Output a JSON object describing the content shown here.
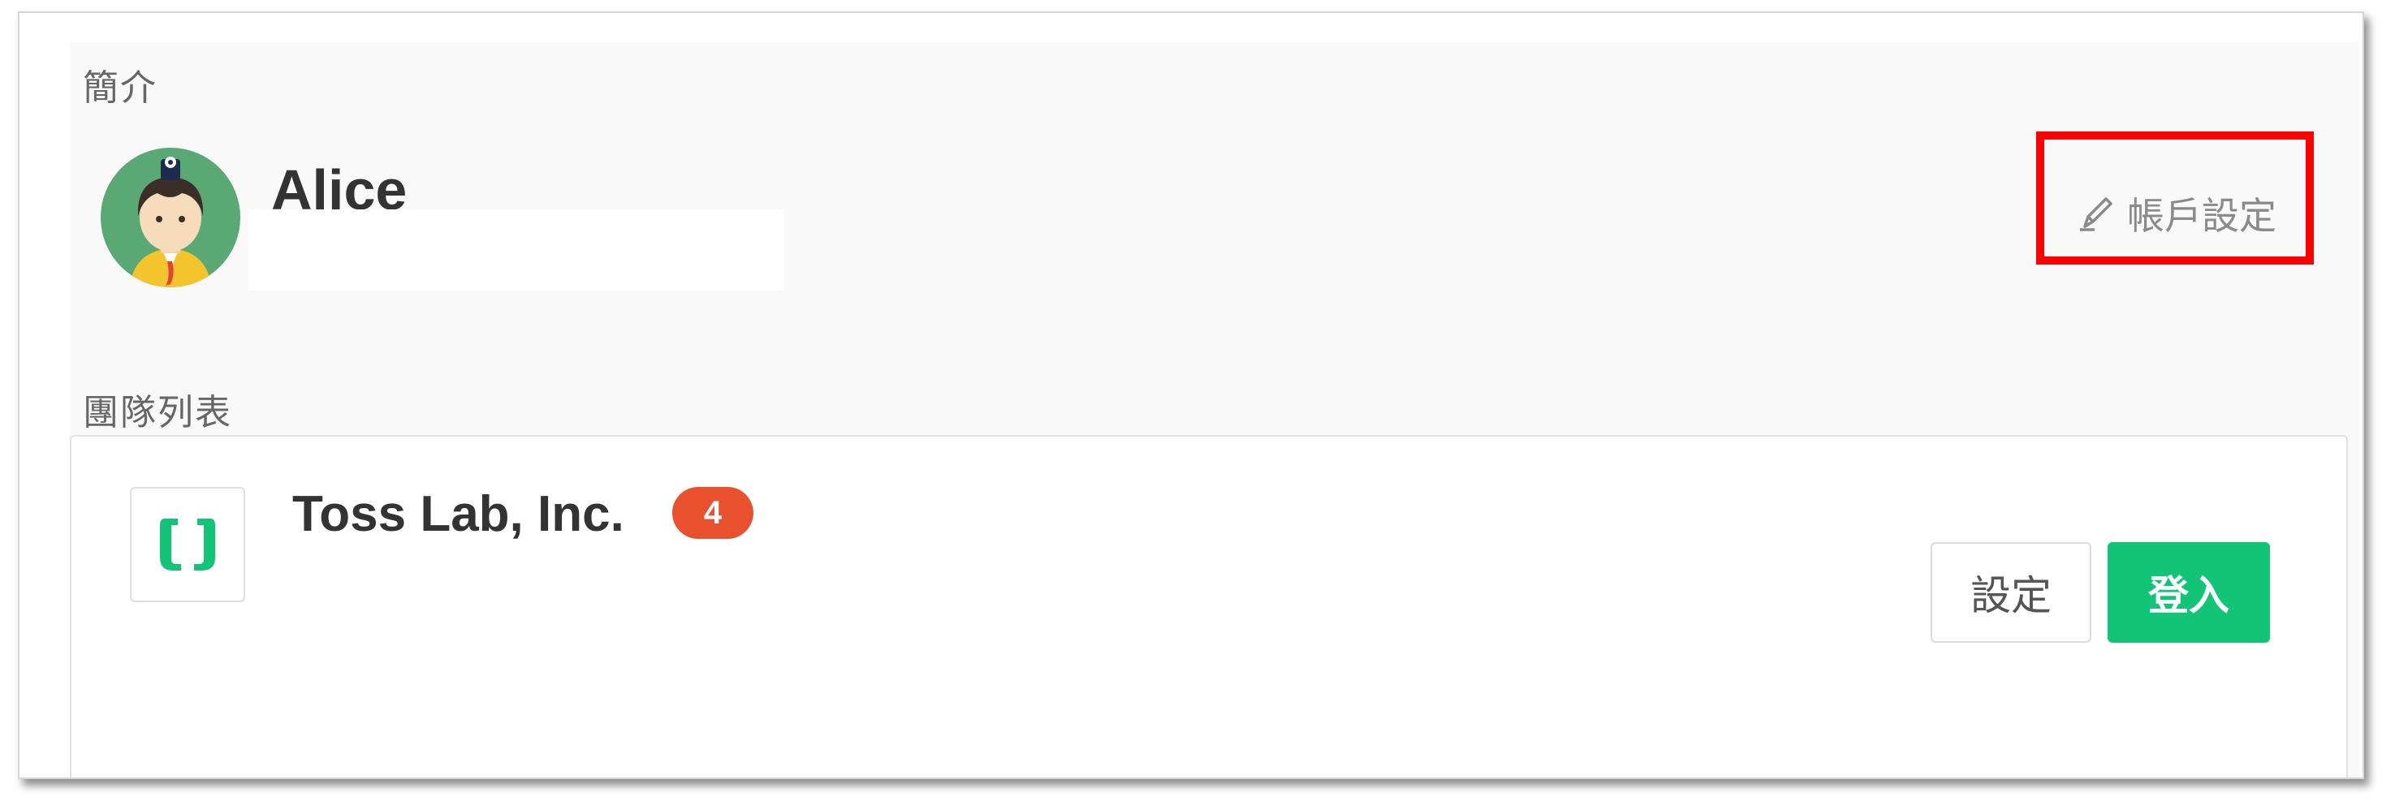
{
  "profile": {
    "section_label": "簡介",
    "user_name": "Alice",
    "account_settings_label": "帳戶設定"
  },
  "teams": {
    "section_label": "團隊列表",
    "items": [
      {
        "name": "Toss Lab, Inc.",
        "badge_count": "4",
        "settings_label": "設定",
        "login_label": "登入"
      }
    ]
  },
  "colors": {
    "brand_green": "#11c476",
    "badge_orange": "#e8502e",
    "highlight_red": "#ff0000",
    "avatar_bg": "#5aa873"
  },
  "icons": {
    "account_settings": "edit-pencil-icon",
    "team_logo": "jandi-logo-icon"
  }
}
